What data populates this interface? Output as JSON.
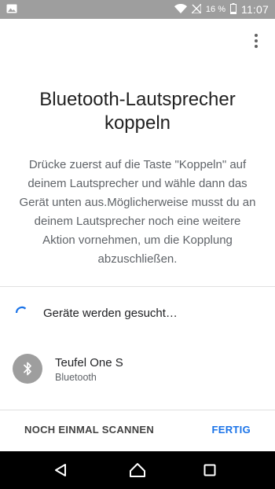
{
  "status_bar": {
    "battery_percent": "16 %",
    "time": "11:07",
    "icons": [
      "image-notification-icon",
      "wifi-icon",
      "no-signal-icon",
      "battery-icon"
    ]
  },
  "menu": {
    "icon": "more-vert-icon"
  },
  "dialog": {
    "title": "Bluetooth-Lautsprecher koppeln",
    "description": "Drücke zuerst auf die Taste \"Koppeln\" auf deinem Lautsprecher und wähle dann das Gerät unten aus.Möglicherweise musst du an deinem Lautsprecher noch eine weitere Aktion vornehmen, um die Kopplung abzuschließen."
  },
  "scan": {
    "status_text": "Geräte werden gesucht…"
  },
  "devices": [
    {
      "name": "Teufel One S",
      "type": "Bluetooth",
      "icon": "bluetooth-icon"
    }
  ],
  "actions": {
    "rescan_label": "NOCH EINMAL SCANNEN",
    "done_label": "FERTIG"
  },
  "colors": {
    "accent": "#1a73e8",
    "status_bar": "#9e9e9e",
    "nav_bar": "#000000"
  }
}
